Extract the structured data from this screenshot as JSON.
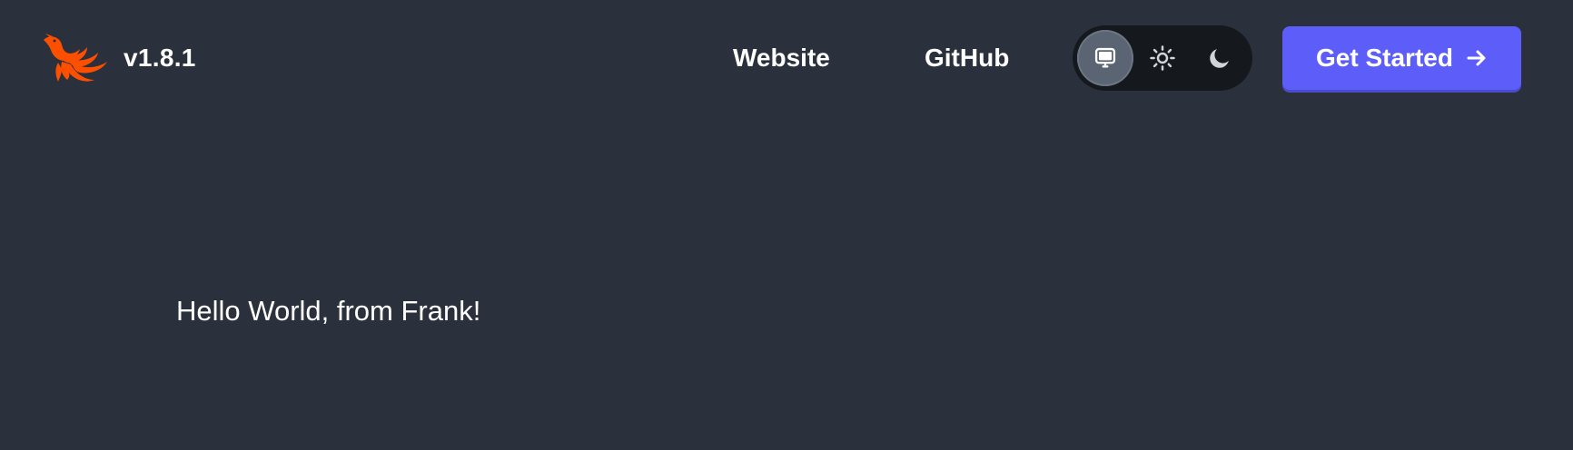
{
  "header": {
    "version": "v1.8.1",
    "logo_icon": "phoenix-logo-icon",
    "nav": {
      "website_label": "Website",
      "github_label": "GitHub"
    },
    "theme_toggle": {
      "selected": "system",
      "options": [
        {
          "id": "system",
          "icon": "monitor-icon"
        },
        {
          "id": "light",
          "icon": "sun-icon"
        },
        {
          "id": "dark",
          "icon": "moon-icon"
        }
      ]
    },
    "cta": {
      "label": "Get Started",
      "icon": "arrow-right-icon"
    }
  },
  "main": {
    "greeting": "Hello World, from Frank!"
  },
  "colors": {
    "background": "#2a303c",
    "toggle_track": "#15191e",
    "toggle_selected": "#5b6472",
    "accent": "#5d5ef9",
    "logo": "#fd4f00"
  }
}
